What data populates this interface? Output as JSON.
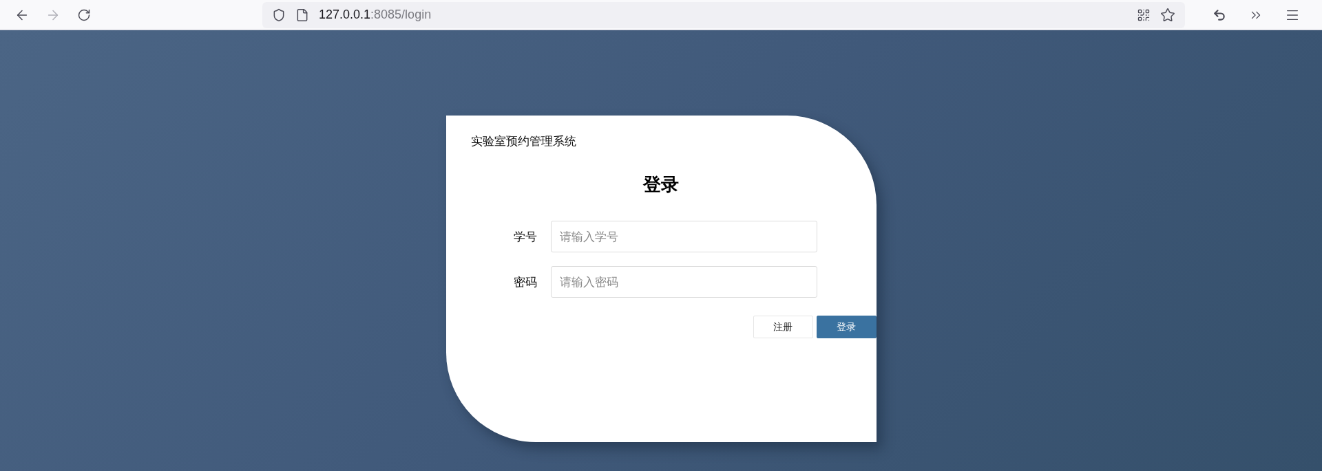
{
  "browser": {
    "url_host": "127.0.0.1",
    "url_path": ":8085/login",
    "forward_disabled": true
  },
  "card": {
    "system_title": "实验室预约管理系统",
    "heading": "登录",
    "fields": [
      {
        "label": "学号",
        "placeholder": "请输入学号"
      },
      {
        "label": "密码",
        "placeholder": "请输入密码"
      }
    ],
    "buttons": [
      {
        "label": "注册",
        "kind": "secondary"
      },
      {
        "label": "登录",
        "kind": "primary"
      }
    ]
  }
}
